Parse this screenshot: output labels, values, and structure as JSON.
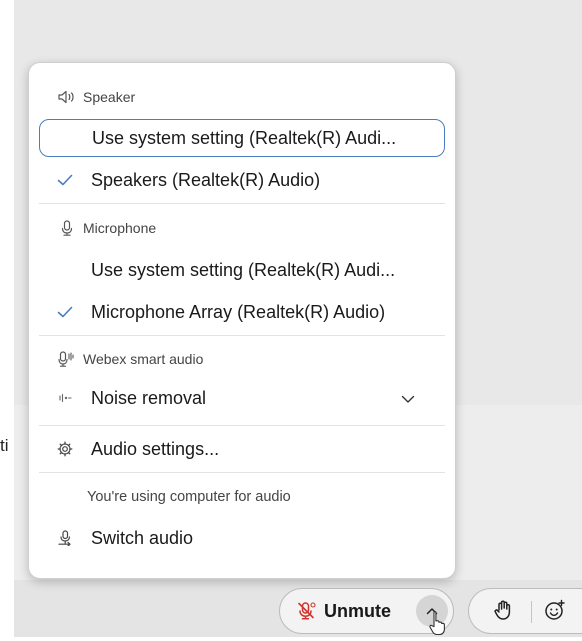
{
  "speaker": {
    "header": "Speaker",
    "options": [
      {
        "label": "Use system setting (Realtek(R) Audi...",
        "checked": false,
        "highlighted": true
      },
      {
        "label": "Speakers (Realtek(R) Audio)",
        "checked": true,
        "highlighted": false
      }
    ]
  },
  "microphone": {
    "header": "Microphone",
    "options": [
      {
        "label": "Use system setting (Realtek(R) Audi...",
        "checked": false
      },
      {
        "label": "Microphone Array (Realtek(R) Audio)",
        "checked": true
      }
    ]
  },
  "smart_audio": {
    "header": "Webex smart audio",
    "selected": "Noise removal"
  },
  "audio_settings_label": "Audio settings...",
  "audio_info": "You're using computer for audio",
  "switch_audio_label": "Switch audio",
  "control_bar": {
    "unmute_label": "Unmute"
  },
  "background_peek_text": "ti",
  "colors": {
    "accent_border": "#4a7dbf",
    "muted_icon": "#d0342c"
  },
  "icons": {
    "speaker": "speaker-icon",
    "check": "check-icon",
    "microphone": "microphone-icon",
    "smart_audio": "smart-audio-icon",
    "noise": "noise-removal-icon",
    "chevron": "chevron-down-icon",
    "gear": "gear-icon",
    "switch": "switch-audio-icon",
    "muted_mic": "muted-microphone-icon",
    "caret": "chevron-up-icon",
    "hand": "raise-hand-icon",
    "emoji": "reactions-icon"
  }
}
